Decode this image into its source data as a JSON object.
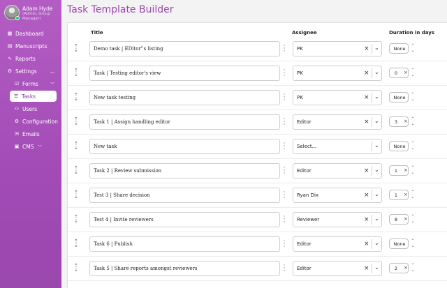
{
  "user": {
    "name": "Adam Hyde",
    "role": "(Admin, Group Manager)"
  },
  "nav": [
    {
      "icon": "▦",
      "label": "Dashboard"
    },
    {
      "icon": "▤",
      "label": "Manuscripts"
    },
    {
      "icon": "∿",
      "label": "Reports"
    },
    {
      "icon": "⚙",
      "label": "Settings"
    },
    {
      "icon": "☑",
      "label": "Forms"
    },
    {
      "icon": "☰",
      "label": "Tasks"
    },
    {
      "icon": "⚇",
      "label": "Users"
    },
    {
      "icon": "⚙",
      "label": "Configuration"
    },
    {
      "icon": "✉",
      "label": "Emails"
    },
    {
      "icon": "▣",
      "label": "CMS"
    }
  ],
  "page_title": "Task Template Builder",
  "columns": {
    "title": "Title",
    "assignee": "Assignee",
    "duration": "Duration in days"
  },
  "rows": [
    {
      "title": "Demo task | EDitor''s listing",
      "assignee": "PK",
      "duration": "None"
    },
    {
      "title": "Task | Testing editor's view",
      "assignee": "PK",
      "duration": "0"
    },
    {
      "title": "New task testing",
      "assignee": "PK",
      "duration": "None"
    },
    {
      "title": "Task 1 | Assign handling editor",
      "assignee": "Editor",
      "duration": "3"
    },
    {
      "title": "New task",
      "assignee": "Select...",
      "duration": "None"
    },
    {
      "title": "Task 2 | Review submission",
      "assignee": "Editor",
      "duration": "1"
    },
    {
      "title": "Test 3 | Share decision",
      "assignee": "Ryan Dix",
      "duration": "1"
    },
    {
      "title": "Test 4 | Invite reviewers",
      "assignee": "Reviewer",
      "duration": "8"
    },
    {
      "title": "Task 6 |  Publish",
      "assignee": "Editor",
      "duration": "None"
    },
    {
      "title": "Task 5 | Share reports amongst reviewers",
      "assignee": "Editor",
      "duration": "2"
    }
  ],
  "colors": {
    "accent": "#9b48ae",
    "sidebar": "#a24bb6"
  }
}
